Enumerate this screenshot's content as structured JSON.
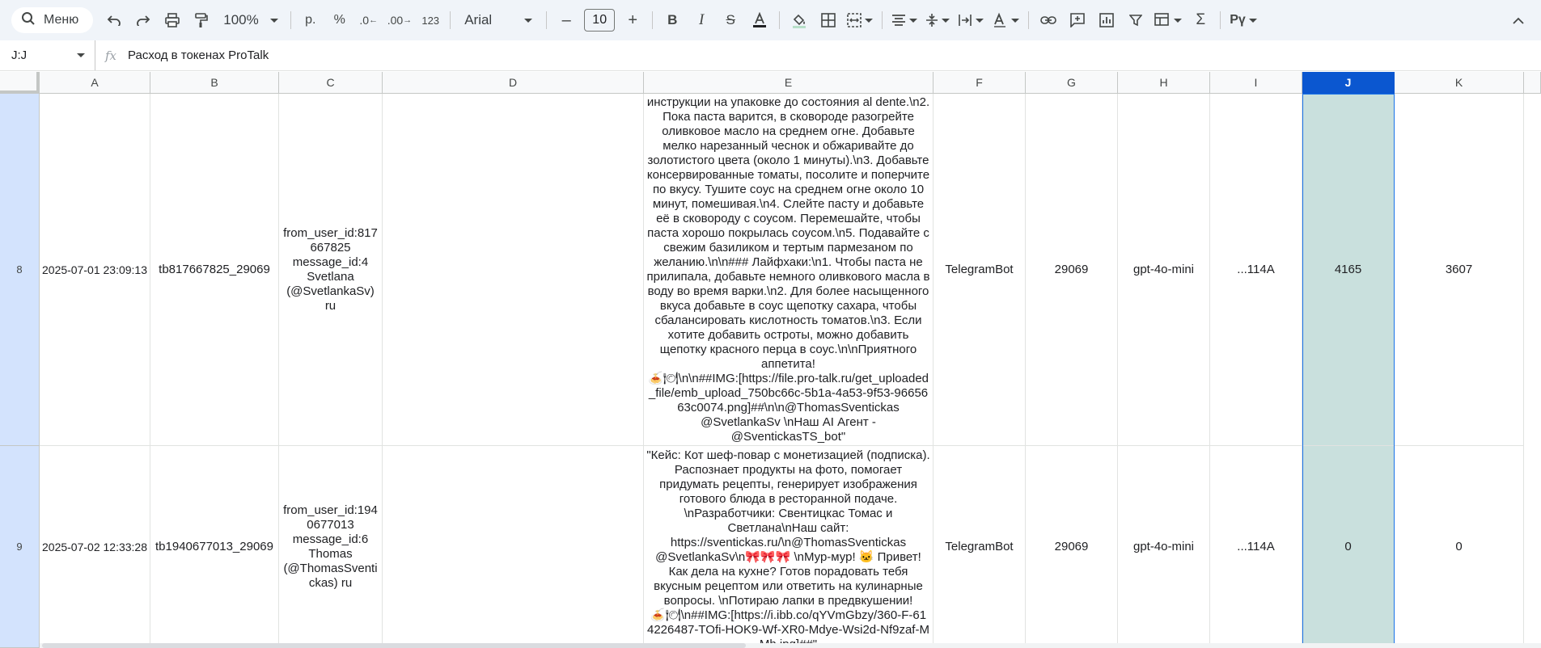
{
  "toolbar": {
    "menu_label": "Меню",
    "zoom": "100%",
    "currency": "р.",
    "percent": "%",
    "decrease_decimal": ".0",
    "increase_decimal": ".00",
    "number_format": "123",
    "font": "Arial",
    "font_size": "10"
  },
  "formula_bar": {
    "name_box": "J:J",
    "fx": "fx",
    "content": "Расход в токенах ProTalk"
  },
  "columns": [
    "A",
    "B",
    "C",
    "D",
    "E",
    "F",
    "G",
    "H",
    "I",
    "J",
    "K"
  ],
  "rows": [
    {
      "number": "8",
      "a": "2025-07-01 23:09:13",
      "b": "tb817667825_29069",
      "c": "from_user_id:817\n667825\nmessage_id:4\nSvetlana\n(@SvetlankaSv)\nru",
      "d": "",
      "e": "инструкции на упаковке до состояния al dente.\\n2.\nПока паста варится, в сковороде разогрейте\nоливковое масло на среднем огне. Добавьте\nмелко нарезанный чеснок и обжаривайте до\nзолотистого цвета (около 1 минуты).\\n3. Добавьте\nконсервированные томаты, посолите и поперчите\nпо вкусу. Тушите соус на среднем огне около 10\nминут, помешивая.\\n4. Слейте пасту и добавьте\nеё в сковороду с соусом. Перемешайте, чтобы\nпаста хорошо покрылась соусом.\\n5. Подавайте с\nсвежим базиликом и тертым пармезаном по\nжеланию.\\n\\n### Лайфхаки:\\n1. Чтобы паста не\nприлипала, добавьте немного оливкового масла в\nводу во время варки.\\n2. Для более насыщенного\nвкуса добавьте в соус щепотку сахара, чтобы\nсбалансировать кислотность томатов.\\n3. Если\nхотите добавить остроты, можно добавить\nщепотку красного перца в соус.\\n\\nПриятного\nаппетита!\n🍝🍽\\n\\n##IMG:[https://file.pro-talk.ru/get_uploaded\n_file/emb_upload_750bc66c-5b1a-4a53-9f53-96656\n63c0074.png]##\\n\\n@ThomasSventickas\n@SvetlankaSv  \\nНаш AI Агент -\n@SventickasTS_bot\"",
      "f": "TelegramBot",
      "g": "29069",
      "h": "gpt-4o-mini",
      "i": "...114A",
      "j": "4165",
      "k": "3607"
    },
    {
      "number": "9",
      "a": "2025-07-02 12:33:28",
      "b": "tb1940677013_29069",
      "c": "from_user_id:194\n0677013\nmessage_id:6\nThomas\n(@ThomasSventi\nckas) ru",
      "d": "",
      "e": "\"Кейс: Кот шеф-повар с монетизацией (подписка).\nРаспознает продукты на фото, помогает\nпридумать рецепты, генерирует изображения\nготового блюда в ресторанной подаче.\n\\nРазработчики: Свентицкас Томас и\nСветлана\\nНаш сайт:\nhttps://sventickas.ru/\\n@ThomasSventickas\n@SvetlankaSv\\n🎀🎀🎀 \\nМур-мур! 🐱 Привет!\nКак дела на кухне? Готов порадовать тебя\nвкусным рецептом или ответить на кулинарные\nвопросы. \\nПотираю лапки в предвкушении!\n🍝🍽\\n##IMG:[https://i.ibb.co/qYVmGbzy/360-F-61\n4226487-TOfi-HOK9-Wf-XR0-Mdye-Wsi2d-Nf9zaf-M\nMh.jpg]##\"",
      "f": "TelegramBot",
      "g": "29069",
      "h": "gpt-4o-mini",
      "i": "...114A",
      "j": "0",
      "k": "0"
    }
  ],
  "icons": [
    "search-icon",
    "undo-icon",
    "redo-icon",
    "print-icon",
    "paint-format-icon",
    "bold-icon",
    "italic-icon",
    "strikethrough-icon",
    "text-color-icon",
    "fill-color-icon",
    "borders-icon",
    "merge-icon",
    "align-icon",
    "valign-icon",
    "wrap-icon",
    "rotate-icon",
    "link-icon",
    "comment-icon",
    "chart-icon",
    "filter-icon",
    "table-view-icon",
    "functions-icon",
    "input-tools-icon",
    "collapse-icon"
  ],
  "colors": {
    "toolbar_bg": "#f0f4f9",
    "selected_header": "#0b57d0",
    "selected_column": "#c9e0dd",
    "row_header": "#d3e3fd"
  }
}
